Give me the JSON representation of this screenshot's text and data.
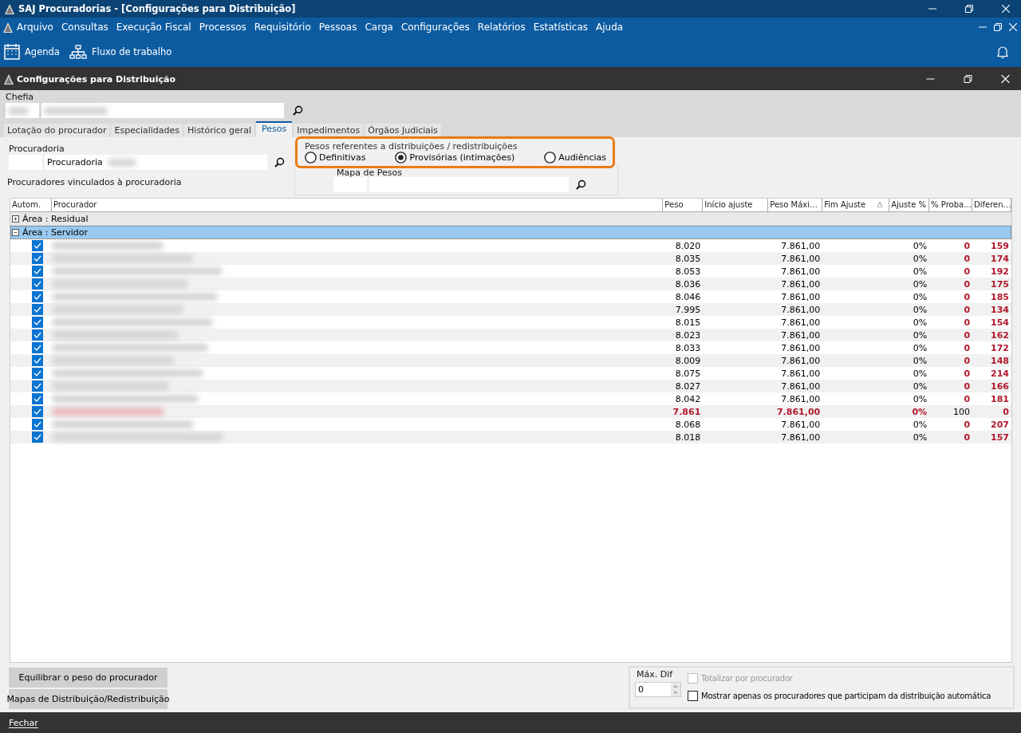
{
  "window": {
    "title": "SAJ Procuradorias - [Configurações para Distribuição]"
  },
  "menu": [
    "Arquivo",
    "Consultas",
    "Execução Fiscal",
    "Processos",
    "Requisitório",
    "Pessoas",
    "Carga",
    "Configurações",
    "Relatórios",
    "Estatísticas",
    "Ajuda"
  ],
  "toolbar": [
    {
      "kind": "calendar",
      "label": "Agenda"
    },
    {
      "kind": "workflow",
      "label": "Fluxo de trabalho"
    }
  ],
  "dialog": {
    "title": "Configurações para Distribuição"
  },
  "chefia": {
    "label": "Chefia"
  },
  "tabs": [
    {
      "label": "Lotação do procurador",
      "selected": false
    },
    {
      "label": "Especialidades",
      "selected": false
    },
    {
      "label": "Histórico geral",
      "selected": false
    },
    {
      "label": "Pesos",
      "selected": true
    },
    {
      "label": "Impedimentos",
      "selected": false
    },
    {
      "label": "Órgãos Judiciais",
      "selected": false
    }
  ],
  "procuradoria": {
    "label": "Procuradoria",
    "value": "Procuradoria"
  },
  "pesos_group": {
    "title": "Pesos referentes a distribuições / redistribuições",
    "options": [
      {
        "label": "Definitivas",
        "selected": false
      },
      {
        "label": "Provisórias (intimações)",
        "selected": true
      },
      {
        "label": "Audiências",
        "selected": false
      }
    ]
  },
  "mapa": {
    "label": "Mapa de Pesos"
  },
  "grid": {
    "caption": "Procuradores vinculados à procuradoria",
    "columns": [
      "Autom.",
      "Procurador",
      "Peso",
      "Início ajuste",
      "Peso Máxi…",
      "Fim Ajuste",
      "Ajuste %",
      "% Proba…",
      "Diferen…"
    ],
    "groups": [
      {
        "label": "Área : Residual",
        "expanded": false,
        "selected": false
      },
      {
        "label": "Área : Servidor",
        "expanded": true,
        "selected": true,
        "rows": [
          {
            "checked": true,
            "highlighted": false,
            "peso": "8.020",
            "peso_max": "7.861,00",
            "ajuste": "0%",
            "proba": "0",
            "diferenca": "159"
          },
          {
            "checked": true,
            "highlighted": false,
            "peso": "8.035",
            "peso_max": "7.861,00",
            "ajuste": "0%",
            "proba": "0",
            "diferenca": "174"
          },
          {
            "checked": true,
            "highlighted": false,
            "peso": "8.053",
            "peso_max": "7.861,00",
            "ajuste": "0%",
            "proba": "0",
            "diferenca": "192"
          },
          {
            "checked": true,
            "highlighted": false,
            "peso": "8.036",
            "peso_max": "7.861,00",
            "ajuste": "0%",
            "proba": "0",
            "diferenca": "175"
          },
          {
            "checked": true,
            "highlighted": false,
            "peso": "8.046",
            "peso_max": "7.861,00",
            "ajuste": "0%",
            "proba": "0",
            "diferenca": "185"
          },
          {
            "checked": true,
            "highlighted": false,
            "peso": "7.995",
            "peso_max": "7.861,00",
            "ajuste": "0%",
            "proba": "0",
            "diferenca": "134"
          },
          {
            "checked": true,
            "highlighted": false,
            "peso": "8.015",
            "peso_max": "7.861,00",
            "ajuste": "0%",
            "proba": "0",
            "diferenca": "154"
          },
          {
            "checked": true,
            "highlighted": false,
            "peso": "8.023",
            "peso_max": "7.861,00",
            "ajuste": "0%",
            "proba": "0",
            "diferenca": "162"
          },
          {
            "checked": true,
            "highlighted": false,
            "peso": "8.033",
            "peso_max": "7.861,00",
            "ajuste": "0%",
            "proba": "0",
            "diferenca": "172"
          },
          {
            "checked": true,
            "highlighted": false,
            "peso": "8.009",
            "peso_max": "7.861,00",
            "ajuste": "0%",
            "proba": "0",
            "diferenca": "148"
          },
          {
            "checked": true,
            "highlighted": false,
            "peso": "8.075",
            "peso_max": "7.861,00",
            "ajuste": "0%",
            "proba": "0",
            "diferenca": "214"
          },
          {
            "checked": true,
            "highlighted": false,
            "peso": "8.027",
            "peso_max": "7.861,00",
            "ajuste": "0%",
            "proba": "0",
            "diferenca": "166"
          },
          {
            "checked": true,
            "highlighted": false,
            "peso": "8.042",
            "peso_max": "7.861,00",
            "ajuste": "0%",
            "proba": "0",
            "diferenca": "181"
          },
          {
            "checked": true,
            "highlighted": true,
            "peso": "7.861",
            "peso_max": "7.861,00",
            "ajuste": "0%",
            "proba": "100",
            "diferenca": "0"
          },
          {
            "checked": true,
            "highlighted": false,
            "peso": "8.068",
            "peso_max": "7.861,00",
            "ajuste": "0%",
            "proba": "0",
            "diferenca": "207"
          },
          {
            "checked": true,
            "highlighted": false,
            "peso": "8.018",
            "peso_max": "7.861,00",
            "ajuste": "0%",
            "proba": "0",
            "diferenca": "157"
          }
        ]
      }
    ]
  },
  "buttons": [
    "Equilibrar o peso do procurador",
    "Mapas de Distribuição/Redistribuição"
  ],
  "max_dif": {
    "label": "Máx. Dif",
    "value": "0"
  },
  "options": [
    {
      "label": "Totalizar por procurador",
      "checked": false,
      "disabled": true
    },
    {
      "label": "Mostrar apenas os procuradores que participam da distribuição automática",
      "checked": false,
      "disabled": false
    }
  ],
  "footer": {
    "close": "Fechar"
  }
}
